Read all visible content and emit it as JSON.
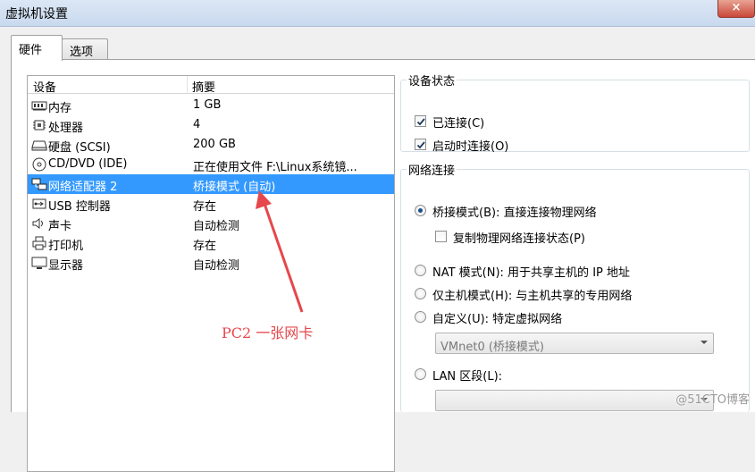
{
  "window": {
    "title": "虚拟机设置",
    "close_glyph": "×"
  },
  "tabs": [
    {
      "label": "硬件",
      "active": true
    },
    {
      "label": "选项",
      "active": false
    }
  ],
  "device_list": {
    "columns": [
      "设备",
      "摘要"
    ],
    "rows": [
      {
        "icon": "memory-icon",
        "name": "内存",
        "summary": "1 GB",
        "selected": false
      },
      {
        "icon": "cpu-icon",
        "name": "处理器",
        "summary": "4",
        "selected": false
      },
      {
        "icon": "harddisk-icon",
        "name": "硬盘 (SCSI)",
        "summary": "200 GB",
        "selected": false
      },
      {
        "icon": "cd-dvd-icon",
        "name": "CD/DVD (IDE)",
        "summary": "正在使用文件 F:\\Linux系统镜...",
        "selected": false
      },
      {
        "icon": "network-adapter-icon",
        "name": "网络适配器 2",
        "summary": "桥接模式 (自动)",
        "selected": true
      },
      {
        "icon": "usb-icon",
        "name": "USB 控制器",
        "summary": "存在",
        "selected": false
      },
      {
        "icon": "sound-icon",
        "name": "声卡",
        "summary": "自动检测",
        "selected": false
      },
      {
        "icon": "printer-icon",
        "name": "打印机",
        "summary": "存在",
        "selected": false
      },
      {
        "icon": "display-icon",
        "name": "显示器",
        "summary": "自动检测",
        "selected": false
      }
    ]
  },
  "device_status": {
    "legend": "设备状态",
    "connected": {
      "label": "已连接(C)",
      "checked": true
    },
    "connect_at_power_on": {
      "label": "启动时连接(O)",
      "checked": true
    }
  },
  "network": {
    "legend": "网络连接",
    "bridged": {
      "label": "桥接模式(B): 直接连接物理网络",
      "selected": true
    },
    "replicate": {
      "label": "复制物理网络连接状态(P)",
      "checked": false
    },
    "nat": {
      "label": "NAT 模式(N): 用于共享主机的 IP 地址",
      "selected": false
    },
    "host_only": {
      "label": "仅主机模式(H): 与主机共享的专用网络",
      "selected": false
    },
    "custom": {
      "label": "自定义(U): 特定虚拟网络",
      "selected": false
    },
    "custom_select_value": "VMnet0 (桥接模式)",
    "lan_segment": {
      "label": "LAN 区段(L):",
      "selected": false
    },
    "lan_select_value": ""
  },
  "annotation": {
    "text": "PC2  一张网卡",
    "color": "#e6474c"
  },
  "watermark": "@51CTO博客",
  "colors": {
    "selection": "#3399ff",
    "annotation": "#e6474c"
  }
}
